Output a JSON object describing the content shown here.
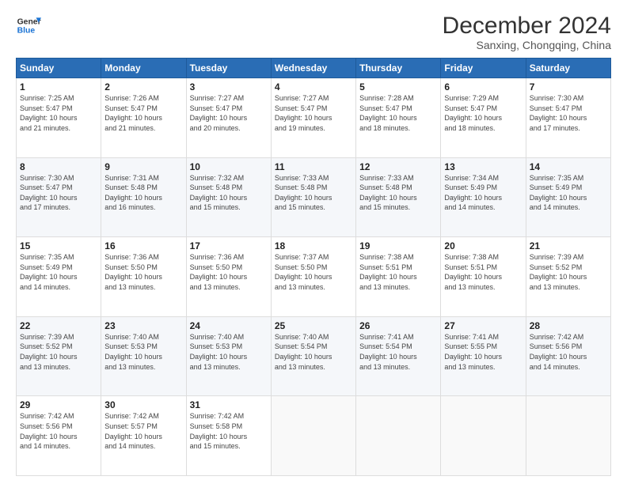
{
  "header": {
    "logo_line1": "General",
    "logo_line2": "Blue",
    "title": "December 2024",
    "subtitle": "Sanxing, Chongqing, China"
  },
  "weekdays": [
    "Sunday",
    "Monday",
    "Tuesday",
    "Wednesday",
    "Thursday",
    "Friday",
    "Saturday"
  ],
  "weeks": [
    [
      {
        "day": "1",
        "info": "Sunrise: 7:25 AM\nSunset: 5:47 PM\nDaylight: 10 hours\nand 21 minutes."
      },
      {
        "day": "2",
        "info": "Sunrise: 7:26 AM\nSunset: 5:47 PM\nDaylight: 10 hours\nand 21 minutes."
      },
      {
        "day": "3",
        "info": "Sunrise: 7:27 AM\nSunset: 5:47 PM\nDaylight: 10 hours\nand 20 minutes."
      },
      {
        "day": "4",
        "info": "Sunrise: 7:27 AM\nSunset: 5:47 PM\nDaylight: 10 hours\nand 19 minutes."
      },
      {
        "day": "5",
        "info": "Sunrise: 7:28 AM\nSunset: 5:47 PM\nDaylight: 10 hours\nand 18 minutes."
      },
      {
        "day": "6",
        "info": "Sunrise: 7:29 AM\nSunset: 5:47 PM\nDaylight: 10 hours\nand 18 minutes."
      },
      {
        "day": "7",
        "info": "Sunrise: 7:30 AM\nSunset: 5:47 PM\nDaylight: 10 hours\nand 17 minutes."
      }
    ],
    [
      {
        "day": "8",
        "info": "Sunrise: 7:30 AM\nSunset: 5:47 PM\nDaylight: 10 hours\nand 17 minutes."
      },
      {
        "day": "9",
        "info": "Sunrise: 7:31 AM\nSunset: 5:48 PM\nDaylight: 10 hours\nand 16 minutes."
      },
      {
        "day": "10",
        "info": "Sunrise: 7:32 AM\nSunset: 5:48 PM\nDaylight: 10 hours\nand 15 minutes."
      },
      {
        "day": "11",
        "info": "Sunrise: 7:33 AM\nSunset: 5:48 PM\nDaylight: 10 hours\nand 15 minutes."
      },
      {
        "day": "12",
        "info": "Sunrise: 7:33 AM\nSunset: 5:48 PM\nDaylight: 10 hours\nand 15 minutes."
      },
      {
        "day": "13",
        "info": "Sunrise: 7:34 AM\nSunset: 5:49 PM\nDaylight: 10 hours\nand 14 minutes."
      },
      {
        "day": "14",
        "info": "Sunrise: 7:35 AM\nSunset: 5:49 PM\nDaylight: 10 hours\nand 14 minutes."
      }
    ],
    [
      {
        "day": "15",
        "info": "Sunrise: 7:35 AM\nSunset: 5:49 PM\nDaylight: 10 hours\nand 14 minutes."
      },
      {
        "day": "16",
        "info": "Sunrise: 7:36 AM\nSunset: 5:50 PM\nDaylight: 10 hours\nand 13 minutes."
      },
      {
        "day": "17",
        "info": "Sunrise: 7:36 AM\nSunset: 5:50 PM\nDaylight: 10 hours\nand 13 minutes."
      },
      {
        "day": "18",
        "info": "Sunrise: 7:37 AM\nSunset: 5:50 PM\nDaylight: 10 hours\nand 13 minutes."
      },
      {
        "day": "19",
        "info": "Sunrise: 7:38 AM\nSunset: 5:51 PM\nDaylight: 10 hours\nand 13 minutes."
      },
      {
        "day": "20",
        "info": "Sunrise: 7:38 AM\nSunset: 5:51 PM\nDaylight: 10 hours\nand 13 minutes."
      },
      {
        "day": "21",
        "info": "Sunrise: 7:39 AM\nSunset: 5:52 PM\nDaylight: 10 hours\nand 13 minutes."
      }
    ],
    [
      {
        "day": "22",
        "info": "Sunrise: 7:39 AM\nSunset: 5:52 PM\nDaylight: 10 hours\nand 13 minutes."
      },
      {
        "day": "23",
        "info": "Sunrise: 7:40 AM\nSunset: 5:53 PM\nDaylight: 10 hours\nand 13 minutes."
      },
      {
        "day": "24",
        "info": "Sunrise: 7:40 AM\nSunset: 5:53 PM\nDaylight: 10 hours\nand 13 minutes."
      },
      {
        "day": "25",
        "info": "Sunrise: 7:40 AM\nSunset: 5:54 PM\nDaylight: 10 hours\nand 13 minutes."
      },
      {
        "day": "26",
        "info": "Sunrise: 7:41 AM\nSunset: 5:54 PM\nDaylight: 10 hours\nand 13 minutes."
      },
      {
        "day": "27",
        "info": "Sunrise: 7:41 AM\nSunset: 5:55 PM\nDaylight: 10 hours\nand 13 minutes."
      },
      {
        "day": "28",
        "info": "Sunrise: 7:42 AM\nSunset: 5:56 PM\nDaylight: 10 hours\nand 14 minutes."
      }
    ],
    [
      {
        "day": "29",
        "info": "Sunrise: 7:42 AM\nSunset: 5:56 PM\nDaylight: 10 hours\nand 14 minutes."
      },
      {
        "day": "30",
        "info": "Sunrise: 7:42 AM\nSunset: 5:57 PM\nDaylight: 10 hours\nand 14 minutes."
      },
      {
        "day": "31",
        "info": "Sunrise: 7:42 AM\nSunset: 5:58 PM\nDaylight: 10 hours\nand 15 minutes."
      },
      {
        "day": "",
        "info": ""
      },
      {
        "day": "",
        "info": ""
      },
      {
        "day": "",
        "info": ""
      },
      {
        "day": "",
        "info": ""
      }
    ]
  ]
}
